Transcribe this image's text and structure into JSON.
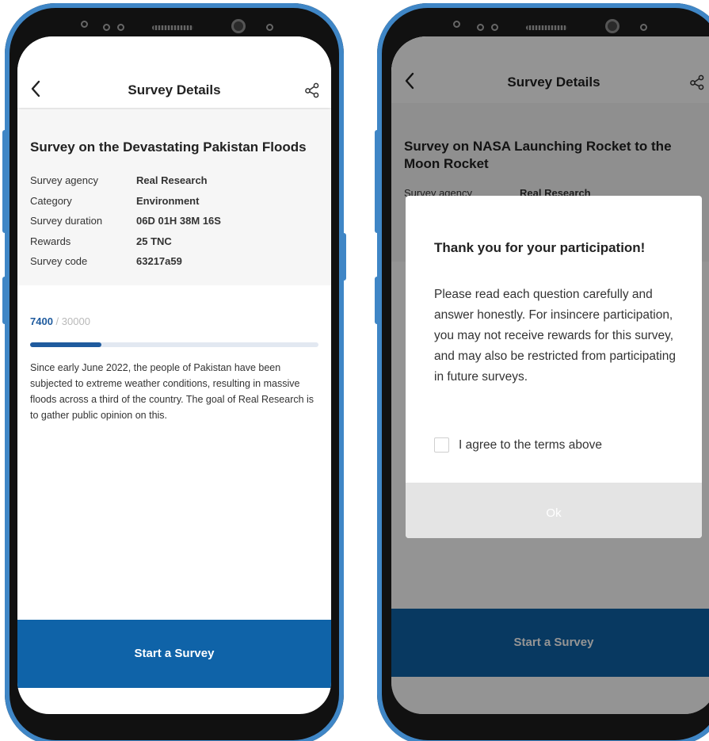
{
  "colors": {
    "frame_blue": "#3f86c6",
    "primary": "#0f63a8",
    "progress": "#1f5b9e",
    "track": "#e2e8f1"
  },
  "left": {
    "header": {
      "title": "Survey Details",
      "back_icon": "chevron-left-icon",
      "share_icon": "share-icon"
    },
    "survey": {
      "title": "Survey on the Devastating Pakistan Floods",
      "details": [
        {
          "label": "Survey agency",
          "value": "Real Research"
        },
        {
          "label": "Category",
          "value": "Environment"
        },
        {
          "label": "Survey duration",
          "value": "06D 01H 38M 16S"
        },
        {
          "label": "Rewards",
          "value": "25 TNC"
        },
        {
          "label": "Survey code",
          "value": "63217a59"
        }
      ]
    },
    "progress": {
      "current": "7400",
      "total": "/ 30000",
      "fraction": 0.2467
    },
    "description": "Since early June 2022, the people of Pakistan have been subjected to extreme weather conditions, resulting in massive floods across a third of the country. The goal of Real Research is to gather public opinion on this.",
    "start_button": "Start a Survey"
  },
  "right": {
    "header": {
      "title": "Survey Details",
      "back_icon": "chevron-left-icon",
      "share_icon": "share-icon"
    },
    "survey": {
      "title": "Survey on NASA Launching Rocket to the Moon Rocket",
      "first_detail": {
        "label": "Survey agency",
        "value": "Real Research"
      }
    },
    "modal": {
      "title": "Thank you for your participation!",
      "message": "Please read each question carefully and answer honestly. For insincere participation, you may not receive rewards for this survey, and may also be restricted from participating in future surveys.",
      "checkbox_label": "I agree to the terms above",
      "ok_button": "Ok"
    },
    "start_button": "Start a Survey"
  }
}
